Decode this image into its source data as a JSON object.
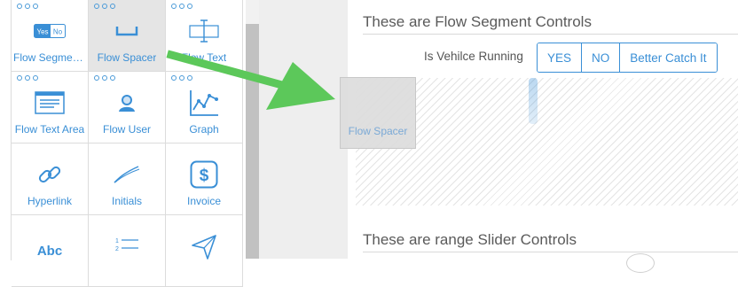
{
  "toolbox": {
    "tiles": [
      {
        "label": "Flow Segment Controls",
        "icon": "yes-no-toggle-icon",
        "selected": false
      },
      {
        "label": "Flow Spacer",
        "icon": "spacer-icon",
        "selected": true
      },
      {
        "label": "Flow Text",
        "icon": "text-cursor-icon",
        "selected": false
      },
      {
        "label": "Flow Text Area",
        "icon": "text-area-icon",
        "selected": false
      },
      {
        "label": "Flow User",
        "icon": "user-icon",
        "selected": false
      },
      {
        "label": "Graph",
        "icon": "graph-icon",
        "selected": false
      },
      {
        "label": "Hyperlink",
        "icon": "chain-link-icon",
        "selected": false
      },
      {
        "label": "Initials",
        "icon": "pen-signature-icon",
        "selected": false
      },
      {
        "label": "Invoice",
        "icon": "dollar-icon",
        "selected": false
      },
      {
        "label": "",
        "icon": "abc-text-icon",
        "selected": false
      },
      {
        "label": "",
        "icon": "numbered-list-icon",
        "selected": false
      },
      {
        "label": "",
        "icon": "paper-plane-icon",
        "selected": false
      }
    ],
    "toggle_yes": "Yes",
    "toggle_no": "No",
    "abc_text": "Abc"
  },
  "canvas": {
    "section1_title": "These are Flow Segment Controls",
    "segment_label": "Is Vehilce Running",
    "segment_options": [
      "YES",
      "NO",
      "Better Catch It"
    ],
    "drag_ghost_label": "Flow Spacer",
    "section2_title": "These are range Slider Controls"
  },
  "colors": {
    "accent": "#3a8fd6",
    "arrow": "#5cc85a",
    "selected_tile": "#e5e5e5"
  }
}
